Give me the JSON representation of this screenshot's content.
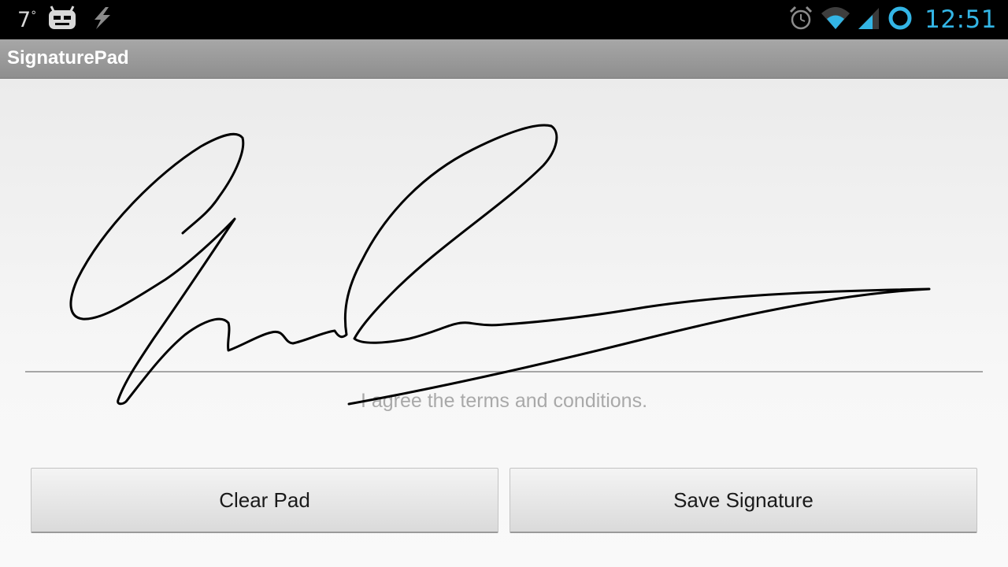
{
  "status_bar": {
    "temperature": "7",
    "temperature_unit": "°",
    "clock": "12:51",
    "left_icons": [
      "cyanogen-mod-icon",
      "lightning-icon"
    ],
    "right_icons": [
      "alarm-icon",
      "wifi-icon",
      "cell-signal-icon",
      "ring-icon"
    ],
    "accent_color": "#33b5e5"
  },
  "action_bar": {
    "title": "SignaturePad"
  },
  "signature_pad": {
    "caption": "I agree the terms and conditions.",
    "stroke_color": "#000000"
  },
  "buttons": {
    "clear_label": "Clear Pad",
    "save_label": "Save Signature"
  }
}
